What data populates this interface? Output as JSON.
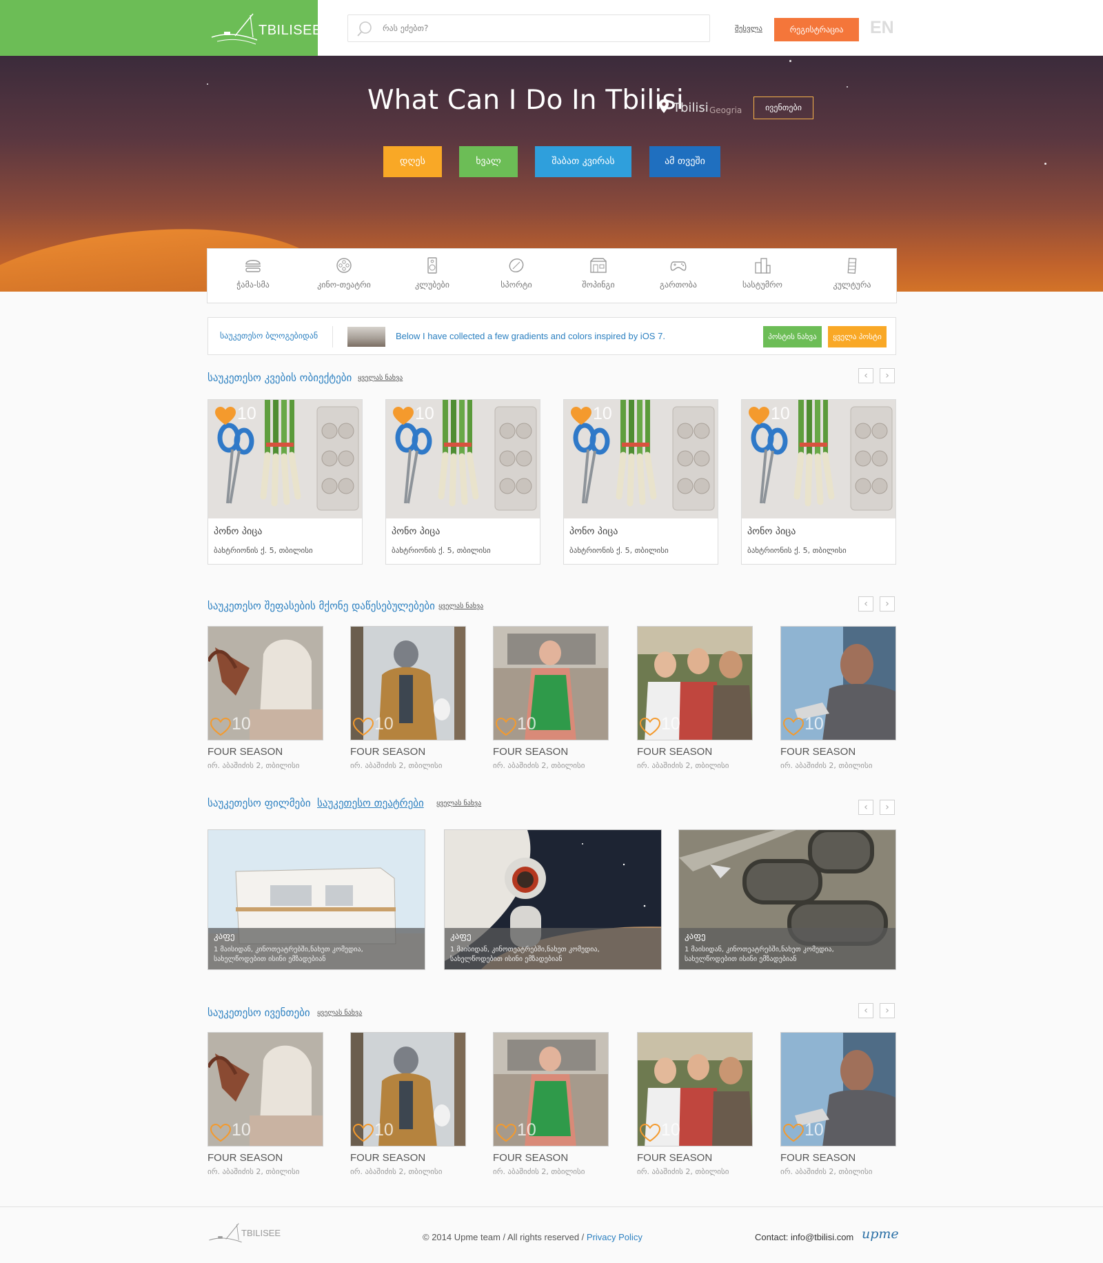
{
  "header": {
    "logo_text": "TBILISEE",
    "search_placeholder": "რას ეძებთ?",
    "login": "შესვლა",
    "register": "რეგისტრაცია",
    "lang": "EN",
    "brand_color": "#6cbd56"
  },
  "hero": {
    "title": "What Can I Do In Tbilisi",
    "city": "Tbilisi",
    "country": "Geogria",
    "events_button": "ივენთები",
    "time_buttons": [
      {
        "label": "დღეს",
        "color": "#f9a826"
      },
      {
        "label": "ხვალ",
        "color": "#6cbd56"
      },
      {
        "label": "შაბათ კვირას",
        "color": "#2f9fdc"
      },
      {
        "label": "ამ თვეში",
        "color": "#1f6fbf"
      }
    ]
  },
  "categories": [
    {
      "label": "ჭამა-სმა",
      "icon": "burger-icon"
    },
    {
      "label": "კინო-თეატრი",
      "icon": "film-reel-icon"
    },
    {
      "label": "კლუბები",
      "icon": "speaker-icon"
    },
    {
      "label": "სპორტი",
      "icon": "ball-icon"
    },
    {
      "label": "შოპინგი",
      "icon": "shop-icon"
    },
    {
      "label": "გართობა",
      "icon": "gamepad-icon"
    },
    {
      "label": "სასტუმრო",
      "icon": "hotel-icon"
    },
    {
      "label": "კულტურა",
      "icon": "tower-icon"
    }
  ],
  "blog": {
    "title": "საუკეთესო ბლოგებიდან",
    "text": "Below I have collected a few gradients and colors inspired by iOS 7.",
    "next_button": "პოსტის ნახვა",
    "all_button": "ყველა პოსტი"
  },
  "food_section": {
    "title": "საუკეთესო კვების ობიექტები",
    "view_all": "ყველას ნახვა",
    "items": [
      {
        "name": "პონო პიცა",
        "address": "ბახტრიონის ქ. 5, თბილისი",
        "likes": "10"
      },
      {
        "name": "პონო პიცა",
        "address": "ბახტრიონის ქ. 5, თბილისი",
        "likes": "10"
      },
      {
        "name": "პონო პიცა",
        "address": "ბახტრიონის ქ. 5, თბილისი",
        "likes": "10"
      },
      {
        "name": "პონო პიცა",
        "address": "ბახტრიონის ქ. 5, თბილისი",
        "likes": "10"
      }
    ]
  },
  "rated_section": {
    "title": "საუკეთესო შეფასების მქონე დაწესებულებები",
    "view_all": "ყველას ნახვა",
    "items": [
      {
        "name": "FOUR SEASON",
        "address": "ირ. აბაშიძის 2, თბილისი",
        "likes": "10"
      },
      {
        "name": "FOUR SEASON",
        "address": "ირ. აბაშიძის 2, თბილისი",
        "likes": "10"
      },
      {
        "name": "FOUR SEASON",
        "address": "ირ. აბაშიძის 2, თბილისი",
        "likes": "10"
      },
      {
        "name": "FOUR SEASON",
        "address": "ირ. აბაშიძის 2, თბილისი",
        "likes": "10"
      },
      {
        "name": "FOUR SEASON",
        "address": "ირ. აბაშიძის 2, თბილისი",
        "likes": "10"
      }
    ]
  },
  "films_section": {
    "tab_films": "საუკეთესო ფილმები",
    "tab_theatres": "საუკეთესო თეატრები",
    "view_all": "ყველას ნახვა",
    "items": [
      {
        "name": "კაფე",
        "desc": "1 მაისიდან, კინოთეატრებში,ნახეთ კომედია, სახელწოდებით ისინი ემზადებიან"
      },
      {
        "name": "კაფე",
        "desc": "1 მაისიდან, კინოთეატრებში,ნახეთ კომედია, სახელწოდებით ისინი ემზადებიან"
      },
      {
        "name": "კაფე",
        "desc": "1 მაისიდან, კინოთეატრებში,ნახეთ კომედია, სახელწოდებით ისინი ემზადებიან"
      }
    ]
  },
  "events_section": {
    "title": "საუკეთესო ივენთები",
    "view_all": "ყველას ნახვა",
    "items": [
      {
        "name": "FOUR SEASON",
        "address": "ირ. აბაშიძის 2, თბილისი",
        "likes": "10"
      },
      {
        "name": "FOUR SEASON",
        "address": "ირ. აბაშიძის 2, თბილისი",
        "likes": "10"
      },
      {
        "name": "FOUR SEASON",
        "address": "ირ. აბაშიძის 2, თბილისი",
        "likes": "10"
      },
      {
        "name": "FOUR SEASON",
        "address": "ირ. აბაშიძის 2, თბილისი",
        "likes": "10"
      },
      {
        "name": "FOUR SEASON",
        "address": "ირ. აბაშიძის 2, თბილისი",
        "likes": "10"
      }
    ]
  },
  "footer": {
    "logo_text": "TBILISEE",
    "copyright": "© 2014 Upme team / All rights reserved / ",
    "privacy": "Privacy Policy",
    "contact": "Contact: info@tbilisi.com",
    "upme": "upme"
  }
}
